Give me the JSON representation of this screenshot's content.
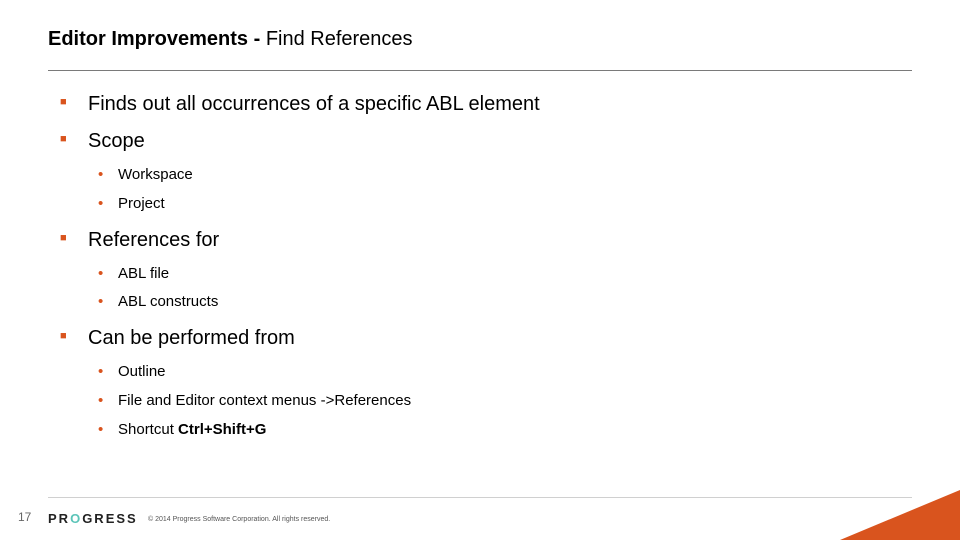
{
  "title_bold": "Editor Improvements - ",
  "title_rest": "Find References",
  "bullets": {
    "b1": "Finds out all occurrences of a specific ABL element",
    "b2": "Scope",
    "b2_items": {
      "i1": "Workspace",
      "i2": "Project"
    },
    "b3": "References for",
    "b3_items": {
      "i1": "ABL file",
      "i2": "ABL constructs"
    },
    "b4": "Can be performed from",
    "b4_items": {
      "i1": "Outline",
      "i2": "File and Editor context menus ->References",
      "i3_prefix": "Shortcut  ",
      "i3_bold": "Ctrl+Shift+G"
    }
  },
  "page_number": "17",
  "logo_first": "PR",
  "logo_second": "O",
  "logo_rest": "GRESS",
  "copyright": "© 2014 Progress Software Corporation. All rights reserved."
}
